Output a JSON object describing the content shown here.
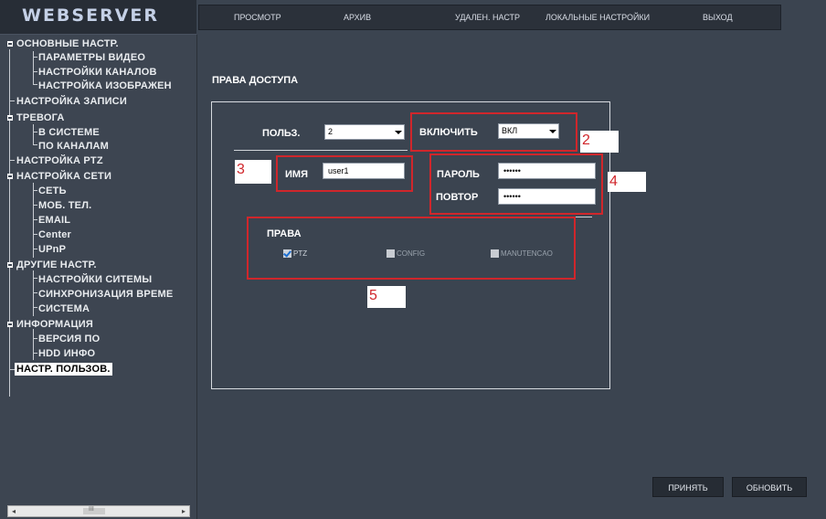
{
  "app": {
    "logo": "WEBSERVER"
  },
  "nav": [
    "ПРОСМОТР",
    "АРХИВ",
    "УДАЛЕН. НАСТР",
    "ЛОКАЛЬНЫЕ НАСТРОЙКИ",
    "ВЫХОД"
  ],
  "sidebar": {
    "items": [
      "ОСНОВНЫЕ НАСТР.",
      "ПАРАМЕТРЫ ВИДЕО",
      "НАСТРОЙКИ КАНАЛОВ",
      "НАСТРОЙКА ИЗОБРАЖЕН",
      "НАСТРОЙКА ЗАПИСИ",
      "ТРЕВОГА",
      "В СИСТЕМЕ",
      "ПО КАНАЛАМ",
      "НАСТРОЙКА PTZ",
      "НАСТРОЙКА СЕТИ",
      "СЕТЬ",
      "МОБ. ТЕЛ.",
      "EMAIL",
      "Center",
      "UPnP",
      "ДРУГИЕ НАСТР.",
      "НАСТРОЙКИ СИТЕМЫ",
      "СИНХРОНИЗАЦИЯ ВРЕМЕ",
      "СИСТЕМА",
      "ИНФОРМАЦИЯ",
      "ВЕРСИЯ ПО",
      "HDD ИНФО",
      "НАСТР. ПОЛЬЗОВ."
    ],
    "scroll_thumb": "III"
  },
  "main": {
    "title": "ПРАВА ДОСТУПА",
    "user_label": "ПОЛЬЗ.",
    "user_value": "2",
    "enable_label": "ВКЛЮЧИТЬ",
    "enable_value": "ВКЛ",
    "name_label": "ИМЯ",
    "name_value": "user1",
    "password_label": "ПАРОЛЬ",
    "password_value": "••••••",
    "repeat_label": "ПОВТОР",
    "repeat_value": "••••••",
    "rights_label": "ПРАВА",
    "rights": [
      {
        "label": "PTZ",
        "checked": true
      },
      {
        "label": "CONFIG",
        "checked": false
      },
      {
        "label": "MANUTENCAO",
        "checked": false
      }
    ],
    "callouts": [
      "2",
      "3",
      "4",
      "5"
    ],
    "buttons": {
      "apply": "ПРИНЯТЬ",
      "refresh": "ОБНОВИТЬ"
    }
  },
  "colors": {
    "background": "#3b4450",
    "annotation_red": "#d0262b",
    "check_blue": "#1c6fd1"
  }
}
